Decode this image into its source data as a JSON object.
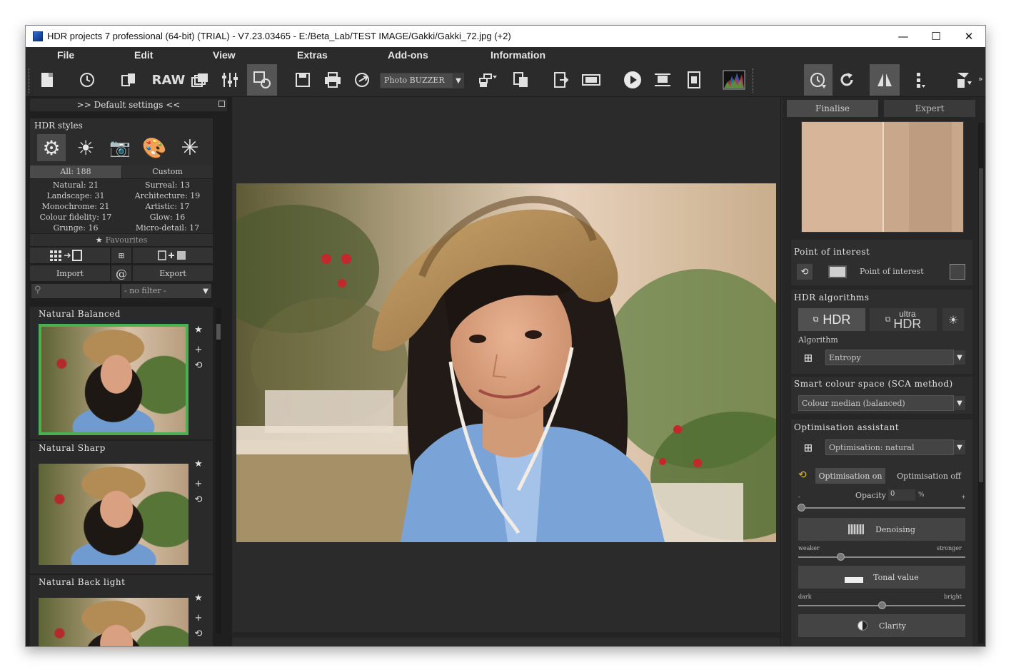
{
  "window": {
    "title": "HDR projects 7 professional (64-bit) (TRIAL) - V7.23.03465 - E:/Beta_Lab/TEST IMAGE/Gakki/Gakki_72.jpg (+2)",
    "minimize": "—",
    "maximize": "☐",
    "close": "✕"
  },
  "menu": [
    "File",
    "Edit",
    "View",
    "Extras",
    "Add-ons",
    "Information"
  ],
  "toolbar": {
    "raw_label": "RAW",
    "preset_select": "Photo BUZZER",
    "icons": [
      "new-file-icon",
      "history-icon",
      "clipboard-icon",
      "raw-icon",
      "stack-icon",
      "adjust-icon",
      "settings-icon",
      "save-icon",
      "print-icon",
      "share-icon",
      "export-icon",
      "compare-icon",
      "video-icon",
      "play-icon",
      "crop-icon",
      "info-icon",
      "histogram-icon",
      "timer-icon",
      "refresh-icon",
      "mirror-icon",
      "dots-icon",
      "adjust-alt-icon"
    ]
  },
  "left": {
    "header": ">> Default settings <<",
    "hdr_styles_title": "HDR styles",
    "tabs": {
      "all": "All: 188",
      "custom": "Custom"
    },
    "categories": [
      [
        "Natural: 21",
        "Surreal: 13"
      ],
      [
        "Landscape: 31",
        "Architecture: 19"
      ],
      [
        "Monochrome: 21",
        "Artistic: 17"
      ],
      [
        "Colour fidelity: 17",
        "Glow: 16"
      ],
      [
        "Grunge: 16",
        "Micro-detail: 17"
      ]
    ],
    "favourites": "Favourites",
    "import": "Import",
    "export": "Export",
    "at_symbol": "@",
    "filter_placeholder": "- no filter -",
    "styles": [
      {
        "title": "Natural Balanced",
        "selected": true
      },
      {
        "title": "Natural Sharp",
        "selected": false
      },
      {
        "title": "Natural Back light",
        "selected": false
      }
    ],
    "star": "★",
    "plus": "+",
    "cycle": "⟲"
  },
  "right": {
    "tabs": [
      "Finalise",
      "Expert"
    ],
    "point_of_interest_title": "Point of interest",
    "point_of_interest_btn": "Point of interest",
    "hdr_algorithms_title": "HDR algorithms",
    "hdr_btn": "HDR",
    "ultra_top": "ultra",
    "ultra_bottom": "HDR",
    "algorithm_label": "Algorithm",
    "algorithm_value": "Entropy",
    "smart_colour_title": "Smart colour space (SCA method)",
    "smart_colour_value": "Colour median (balanced)",
    "optimisation_title": "Optimisation assistant",
    "optimisation_value": "Optimisation: natural",
    "opt_on": "Optimisation on",
    "opt_off": "Optimisation off",
    "opacity_label": "Opacity",
    "opacity_value": "0",
    "percent": "%",
    "minus": "-",
    "plus": "+",
    "opacity_level": 0,
    "denoising": "Denoising",
    "weaker": "weaker",
    "stronger": "stronger",
    "denoising_level": 0.25,
    "tonal": "Tonal value",
    "dark": "dark",
    "bright": "bright",
    "tonal_level": 0.5,
    "clarity": "Clarity"
  },
  "colors": {
    "selection": "#4caf50",
    "background": "#2b2b2b",
    "panel": "#1f1f1f"
  }
}
